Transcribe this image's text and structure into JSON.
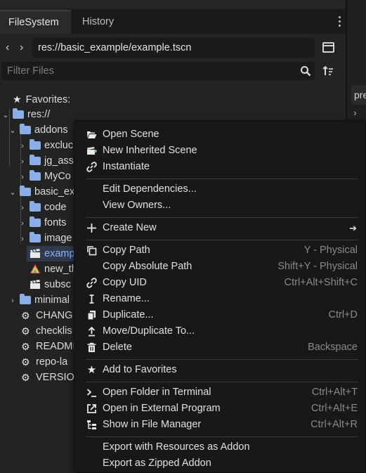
{
  "tabs": {
    "filesystem": "FileSystem",
    "history": "History"
  },
  "path": {
    "value": "res://basic_example/example.tscn",
    "back": "‹",
    "forward": "›"
  },
  "filter": {
    "placeholder": "Filter Files"
  },
  "right_panel": {
    "tab_label": "pre",
    "chevron": "›"
  },
  "tree": {
    "favorites": "Favorites:",
    "root": "res://",
    "addons": "addons",
    "addons_children": [
      "excluc",
      "jg_ass",
      "MyCo"
    ],
    "basic_example": "basic_ex",
    "basic_children": [
      "code",
      "fonts",
      "image"
    ],
    "scene_selected": "examp",
    "new_theme": "new_th",
    "subscene": "subsc",
    "minimal": "minimal",
    "files": [
      "CHANG",
      "checklis",
      "READMI",
      "repo-la",
      "VERSIO"
    ]
  },
  "menu": {
    "items": [
      {
        "label": "Open Scene",
        "icon": "folder-open-icon"
      },
      {
        "label": "New Inherited Scene",
        "icon": "clapboard-plus-icon"
      },
      {
        "label": "Instantiate",
        "icon": "link-icon"
      },
      {
        "label": "Edit Dependencies...",
        "icon": ""
      },
      {
        "label": "View Owners...",
        "icon": ""
      },
      {
        "label": "Create New",
        "icon": "plus-icon",
        "submenu": "➔"
      },
      {
        "label": "Copy Path",
        "icon": "copy-icon",
        "shortcut": "Y - Physical"
      },
      {
        "label": "Copy Absolute Path",
        "icon": "",
        "shortcut": "Shift+Y - Physical"
      },
      {
        "label": "Copy UID",
        "icon": "link-icon",
        "shortcut": "Ctrl+Alt+Shift+C"
      },
      {
        "label": "Rename...",
        "icon": "text-cursor-icon"
      },
      {
        "label": "Duplicate...",
        "icon": "duplicate-icon",
        "shortcut": "Ctrl+D"
      },
      {
        "label": "Move/Duplicate To...",
        "icon": "upload-arrow-icon"
      },
      {
        "label": "Delete",
        "icon": "trash-icon",
        "shortcut": "Backspace"
      },
      {
        "label": "Add to Favorites",
        "icon": "star-icon"
      },
      {
        "label": "Open Folder in Terminal",
        "icon": "terminal-icon",
        "shortcut": "Ctrl+Alt+T"
      },
      {
        "label": "Open in External Program",
        "icon": "external-link-icon",
        "shortcut": "Ctrl+Alt+E"
      },
      {
        "label": "Show in File Manager",
        "icon": "file-tree-icon",
        "shortcut": "Ctrl+Alt+R"
      },
      {
        "label": "Export with Resources as Addon",
        "icon": ""
      },
      {
        "label": "Export as Zipped Addon",
        "icon": ""
      }
    ]
  }
}
